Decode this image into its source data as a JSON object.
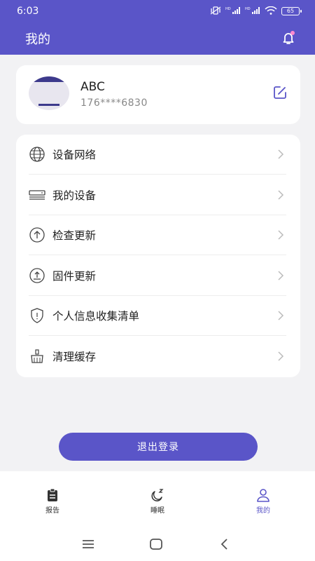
{
  "status_bar": {
    "time": "6:03",
    "battery": "65"
  },
  "header": {
    "title": "我的"
  },
  "profile": {
    "name": "ABC",
    "phone": "176****6830"
  },
  "menu": [
    {
      "label": "设备网络",
      "icon": "globe-icon"
    },
    {
      "label": "我的设备",
      "icon": "device-icon"
    },
    {
      "label": "检查更新",
      "icon": "upload-circle-icon"
    },
    {
      "label": "固件更新",
      "icon": "firmware-icon"
    },
    {
      "label": "个人信息收集清单",
      "icon": "shield-icon"
    },
    {
      "label": "清理缓存",
      "icon": "broom-icon"
    }
  ],
  "logout_label": "退出登录",
  "tabs": [
    {
      "label": "报告",
      "icon": "clipboard-icon",
      "active": false
    },
    {
      "label": "睡眠",
      "icon": "moon-icon",
      "active": false
    },
    {
      "label": "我的",
      "icon": "person-icon",
      "active": true
    }
  ],
  "colors": {
    "accent": "#5a55c8",
    "background": "#f2f2f4"
  }
}
